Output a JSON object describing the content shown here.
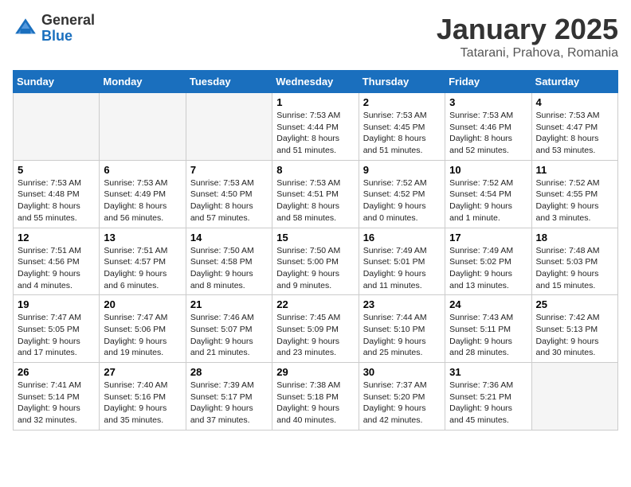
{
  "logo": {
    "general": "General",
    "blue": "Blue"
  },
  "title": "January 2025",
  "location": "Tatarani, Prahova, Romania",
  "days_header": [
    "Sunday",
    "Monday",
    "Tuesday",
    "Wednesday",
    "Thursday",
    "Friday",
    "Saturday"
  ],
  "weeks": [
    [
      {
        "day": "",
        "info": ""
      },
      {
        "day": "",
        "info": ""
      },
      {
        "day": "",
        "info": ""
      },
      {
        "day": "1",
        "info": "Sunrise: 7:53 AM\nSunset: 4:44 PM\nDaylight: 8 hours\nand 51 minutes."
      },
      {
        "day": "2",
        "info": "Sunrise: 7:53 AM\nSunset: 4:45 PM\nDaylight: 8 hours\nand 51 minutes."
      },
      {
        "day": "3",
        "info": "Sunrise: 7:53 AM\nSunset: 4:46 PM\nDaylight: 8 hours\nand 52 minutes."
      },
      {
        "day": "4",
        "info": "Sunrise: 7:53 AM\nSunset: 4:47 PM\nDaylight: 8 hours\nand 53 minutes."
      }
    ],
    [
      {
        "day": "5",
        "info": "Sunrise: 7:53 AM\nSunset: 4:48 PM\nDaylight: 8 hours\nand 55 minutes."
      },
      {
        "day": "6",
        "info": "Sunrise: 7:53 AM\nSunset: 4:49 PM\nDaylight: 8 hours\nand 56 minutes."
      },
      {
        "day": "7",
        "info": "Sunrise: 7:53 AM\nSunset: 4:50 PM\nDaylight: 8 hours\nand 57 minutes."
      },
      {
        "day": "8",
        "info": "Sunrise: 7:53 AM\nSunset: 4:51 PM\nDaylight: 8 hours\nand 58 minutes."
      },
      {
        "day": "9",
        "info": "Sunrise: 7:52 AM\nSunset: 4:52 PM\nDaylight: 9 hours\nand 0 minutes."
      },
      {
        "day": "10",
        "info": "Sunrise: 7:52 AM\nSunset: 4:54 PM\nDaylight: 9 hours\nand 1 minute."
      },
      {
        "day": "11",
        "info": "Sunrise: 7:52 AM\nSunset: 4:55 PM\nDaylight: 9 hours\nand 3 minutes."
      }
    ],
    [
      {
        "day": "12",
        "info": "Sunrise: 7:51 AM\nSunset: 4:56 PM\nDaylight: 9 hours\nand 4 minutes."
      },
      {
        "day": "13",
        "info": "Sunrise: 7:51 AM\nSunset: 4:57 PM\nDaylight: 9 hours\nand 6 minutes."
      },
      {
        "day": "14",
        "info": "Sunrise: 7:50 AM\nSunset: 4:58 PM\nDaylight: 9 hours\nand 8 minutes."
      },
      {
        "day": "15",
        "info": "Sunrise: 7:50 AM\nSunset: 5:00 PM\nDaylight: 9 hours\nand 9 minutes."
      },
      {
        "day": "16",
        "info": "Sunrise: 7:49 AM\nSunset: 5:01 PM\nDaylight: 9 hours\nand 11 minutes."
      },
      {
        "day": "17",
        "info": "Sunrise: 7:49 AM\nSunset: 5:02 PM\nDaylight: 9 hours\nand 13 minutes."
      },
      {
        "day": "18",
        "info": "Sunrise: 7:48 AM\nSunset: 5:03 PM\nDaylight: 9 hours\nand 15 minutes."
      }
    ],
    [
      {
        "day": "19",
        "info": "Sunrise: 7:47 AM\nSunset: 5:05 PM\nDaylight: 9 hours\nand 17 minutes."
      },
      {
        "day": "20",
        "info": "Sunrise: 7:47 AM\nSunset: 5:06 PM\nDaylight: 9 hours\nand 19 minutes."
      },
      {
        "day": "21",
        "info": "Sunrise: 7:46 AM\nSunset: 5:07 PM\nDaylight: 9 hours\nand 21 minutes."
      },
      {
        "day": "22",
        "info": "Sunrise: 7:45 AM\nSunset: 5:09 PM\nDaylight: 9 hours\nand 23 minutes."
      },
      {
        "day": "23",
        "info": "Sunrise: 7:44 AM\nSunset: 5:10 PM\nDaylight: 9 hours\nand 25 minutes."
      },
      {
        "day": "24",
        "info": "Sunrise: 7:43 AM\nSunset: 5:11 PM\nDaylight: 9 hours\nand 28 minutes."
      },
      {
        "day": "25",
        "info": "Sunrise: 7:42 AM\nSunset: 5:13 PM\nDaylight: 9 hours\nand 30 minutes."
      }
    ],
    [
      {
        "day": "26",
        "info": "Sunrise: 7:41 AM\nSunset: 5:14 PM\nDaylight: 9 hours\nand 32 minutes."
      },
      {
        "day": "27",
        "info": "Sunrise: 7:40 AM\nSunset: 5:16 PM\nDaylight: 9 hours\nand 35 minutes."
      },
      {
        "day": "28",
        "info": "Sunrise: 7:39 AM\nSunset: 5:17 PM\nDaylight: 9 hours\nand 37 minutes."
      },
      {
        "day": "29",
        "info": "Sunrise: 7:38 AM\nSunset: 5:18 PM\nDaylight: 9 hours\nand 40 minutes."
      },
      {
        "day": "30",
        "info": "Sunrise: 7:37 AM\nSunset: 5:20 PM\nDaylight: 9 hours\nand 42 minutes."
      },
      {
        "day": "31",
        "info": "Sunrise: 7:36 AM\nSunset: 5:21 PM\nDaylight: 9 hours\nand 45 minutes."
      },
      {
        "day": "",
        "info": ""
      }
    ]
  ]
}
